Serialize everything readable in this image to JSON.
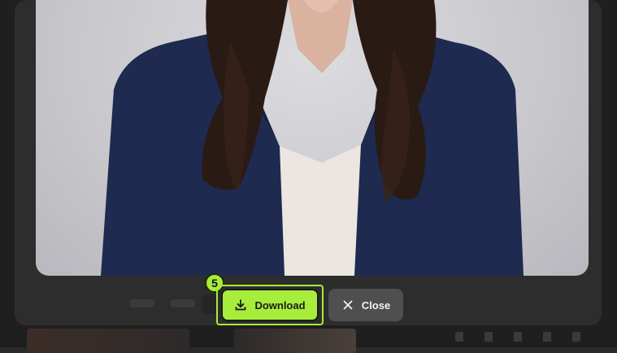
{
  "viewer": {
    "image_alt": "Portrait of a woman with long dark hair wearing a navy blazer",
    "step_badge": "5",
    "download_label": "Download",
    "close_label": "Close"
  },
  "icons": {
    "download": "download-icon",
    "close": "close-icon"
  },
  "colors": {
    "accent": "#a8ec3c",
    "close_bg": "#4f4f4f",
    "backdrop": "#2b2b2b"
  }
}
